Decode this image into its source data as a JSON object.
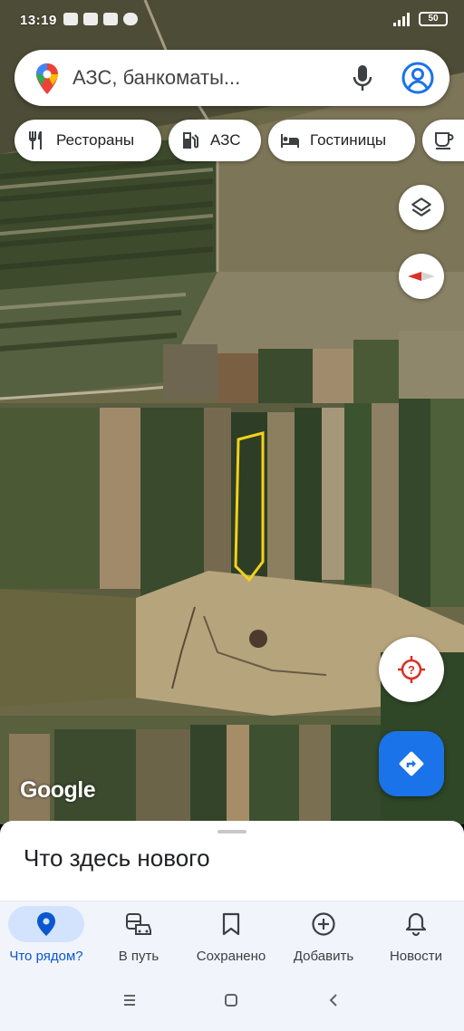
{
  "status_bar": {
    "time": "13:19",
    "battery": "50"
  },
  "search": {
    "placeholder": "АЗС, банкоматы...",
    "logo_icon": "maps-pin-icon",
    "mic_icon": "mic-icon",
    "account_icon": "account-circle-icon"
  },
  "chips": [
    {
      "label": "Рестораны",
      "icon": "fork-knife-icon"
    },
    {
      "label": "АЗС",
      "icon": "gas-station-icon"
    },
    {
      "label": "Гостиницы",
      "icon": "bed-icon"
    },
    {
      "label": "",
      "icon": "coffee-icon"
    }
  ],
  "map": {
    "attribution": "Google",
    "layers_icon": "layers-icon",
    "compass_icon": "compass-icon",
    "locate_icon": "my-location-icon",
    "directions_icon": "directions-icon",
    "highlight_color": "#f3d11b"
  },
  "sheet": {
    "title": "Что здесь нового"
  },
  "bottom_nav": [
    {
      "label": "Что рядом?",
      "icon": "explore-pin-icon",
      "active": true
    },
    {
      "label": "В путь",
      "icon": "commute-icon",
      "active": false
    },
    {
      "label": "Сохранено",
      "icon": "bookmark-icon",
      "active": false
    },
    {
      "label": "Добавить",
      "icon": "add-circle-icon",
      "active": false
    },
    {
      "label": "Новости",
      "icon": "bell-icon",
      "active": false
    }
  ],
  "system_nav": {
    "menu_icon": "recents-icon",
    "home_icon": "home-square-icon",
    "back_icon": "back-chevron-icon"
  },
  "colors": {
    "accent": "#1a73e8",
    "active_nav": "#0b57d0",
    "locate_red": "#d93025"
  }
}
